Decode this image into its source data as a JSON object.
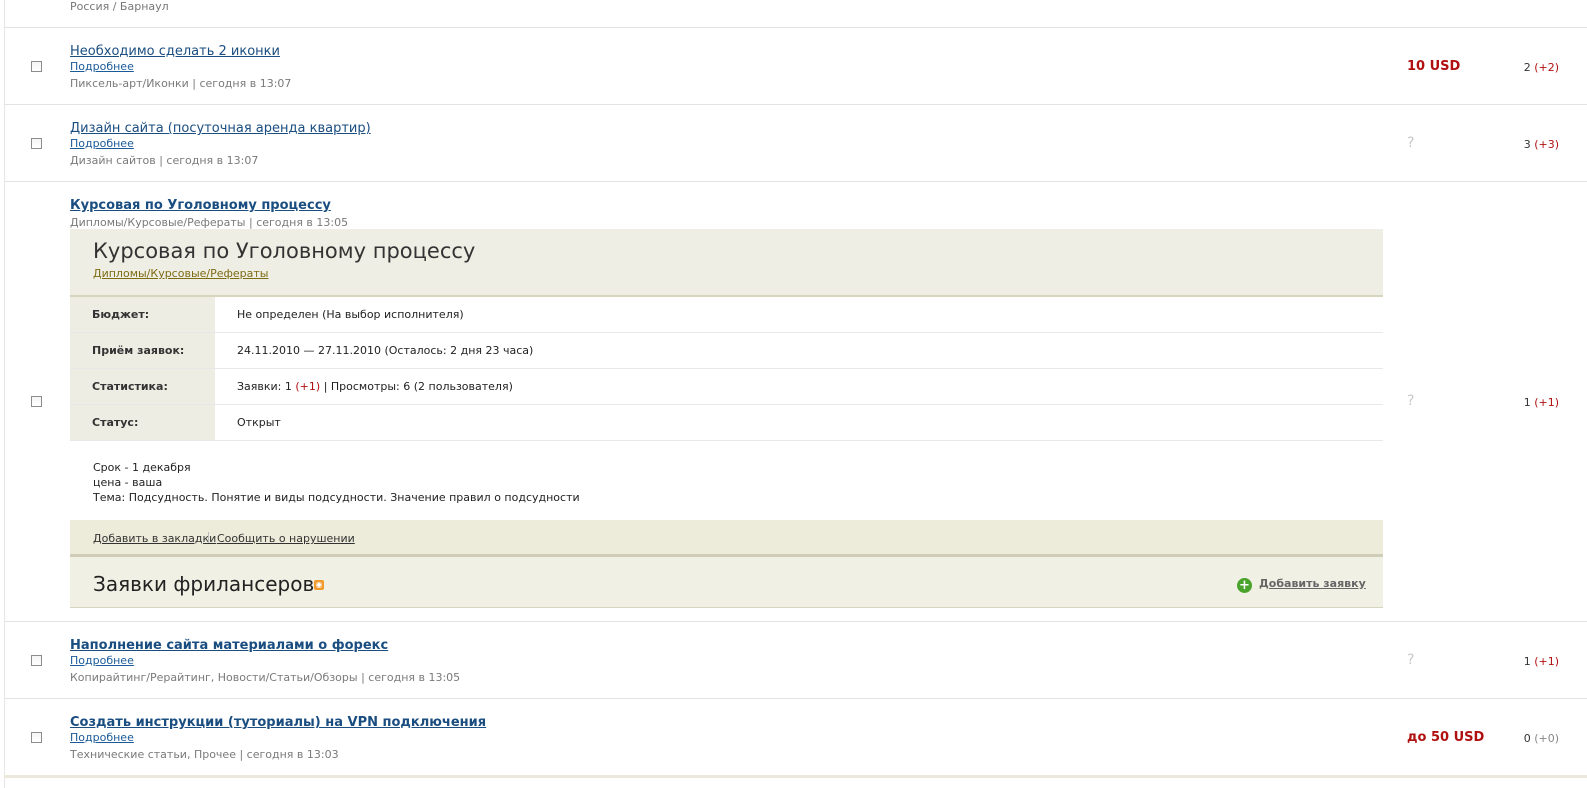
{
  "top_location": "Россия / Барнаул",
  "projects": [
    {
      "title": "Необходимо сделать 2 иконки",
      "more": "Подробнее",
      "meta": "Пиксель-арт/Иконки | сегодня в 13:07",
      "budget": "10 USD",
      "offers": "2",
      "offers_delta": "(+2)"
    },
    {
      "title": "Дизайн сайта (посуточная аренда квартир)",
      "more": "Подробнее",
      "meta": "Дизайн сайтов | сегодня в 13:07",
      "budget": "?",
      "offers": "3",
      "offers_delta": "(+3)"
    },
    {
      "title": "Курсовая по Уголовному процессу",
      "meta": "Дипломы/Курсовые/Рефераты | сегодня в 13:05",
      "budget": "?",
      "offers": "1",
      "offers_delta": "(+1)"
    },
    {
      "title": "Наполнение сайта материалами о форекс",
      "more": "Подробнее",
      "meta": "Копирайтинг/Рерайтинг, Новости/Статьи/Обзоры | сегодня в 13:05",
      "budget": "?",
      "offers": "1",
      "offers_delta": "(+1)"
    },
    {
      "title": "Создать инструкции (туториалы) на VPN подключения",
      "more": "Подробнее",
      "meta": "Технические статьи, Прочее | сегодня в 13:03",
      "budget": "до 50 USD",
      "offers": "0",
      "offers_delta": "(+0)"
    }
  ],
  "detail": {
    "title": "Курсовая по Уголовному процессу",
    "category": "Дипломы/Курсовые/Рефераты",
    "rows": [
      {
        "label": "Бюджет:",
        "value": "Не определен (На выбор исполнителя)"
      },
      {
        "label": "Приём заявок:",
        "value": "24.11.2010 — 27.11.2010  (Осталось: 2 дня 23 часа)"
      },
      {
        "label": "Статистика:",
        "value_pre": "Заявки: 1 ",
        "value_delta": "(+1)",
        "value_post": "  |  Просмотры: 6 (2 пользователя)"
      },
      {
        "label": "Статус:",
        "value": "Открыт"
      }
    ],
    "description": [
      "Срок - 1 декабря",
      "цена - ваша",
      "Тема: Подсудность. Понятие и виды подсудности. Значение правил о подсудности"
    ],
    "bookmark_label": "Добавить в закладки",
    "report_label": "Сообщить о нарушении",
    "applications_title": "Заявки фрилансеров",
    "rss_icon": "rss-icon",
    "add_application_label": "Добавить заявку"
  }
}
